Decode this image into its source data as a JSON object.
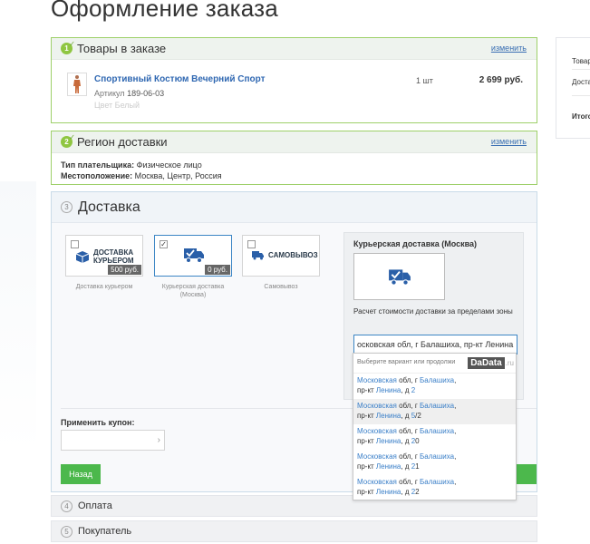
{
  "page": {
    "title": "Оформление заказа"
  },
  "products": {
    "step": "1",
    "title": "Товары в заказе",
    "edit": "изменить",
    "item": {
      "name": "Спортивный Костюм Вечерний Спорт",
      "article_label": "Артикул",
      "article": "189-06-03",
      "color": "Цвет Белый",
      "qty": "1 шт",
      "price": "2 699 руб."
    }
  },
  "region": {
    "step": "2",
    "title": "Регион доставки",
    "edit": "изменить",
    "payer_label": "Тип плательщика:",
    "payer": "Физическое лицо",
    "location_label": "Местоположение:",
    "location": "Москва, Центр, Россия"
  },
  "delivery": {
    "step": "3",
    "title": "Доставка",
    "options": [
      {
        "logo": "ДОСТАВКА КУРЬЕРОМ",
        "price": "500 руб.",
        "caption": "Доставка курьером",
        "checked": ""
      },
      {
        "logo": "",
        "price": "0 руб.",
        "caption": "Курьерская доставка (Москва)",
        "checked": "✓"
      },
      {
        "logo": "САМОВЫВОЗ",
        "price": "",
        "caption": "Самовывоз",
        "checked": ""
      }
    ],
    "panel": {
      "title": "Курьерская доставка (Москва)",
      "desc": "Расчет стоимости доставки за пределами зоны",
      "address_value": "осковская обл, г Балашиха, пр-кт Ленина, д"
    },
    "coupon_label": "Применить купон:",
    "back": "Назад"
  },
  "suggest": {
    "hint": "Выберите вариант или продолжи",
    "brand": "DaData",
    "brand_suffix": ".ru",
    "items": [
      {
        "a": "Московская",
        "b": " обл, г ",
        "c": "Балашиха",
        "d": ",",
        "e": "пр-кт ",
        "f": "Ленина",
        "g": ", д ",
        "h": "2",
        "i": ""
      },
      {
        "a": "Московская",
        "b": " обл, г ",
        "c": "Балашиха",
        "d": ",",
        "e": "пр-кт ",
        "f": "Ленина",
        "g": ", д ",
        "h": "5",
        "i": "/2"
      },
      {
        "a": "Московская",
        "b": " обл, г ",
        "c": "Балашиха",
        "d": ",",
        "e": "пр-кт ",
        "f": "Ленина",
        "g": ", д ",
        "h": "2",
        "i": "0"
      },
      {
        "a": "Московская",
        "b": " обл, г ",
        "c": "Балашиха",
        "d": ",",
        "e": "пр-кт ",
        "f": "Ленина",
        "g": ", д ",
        "h": "2",
        "i": "1"
      },
      {
        "a": "Московская",
        "b": " обл, г ",
        "c": "Балашиха",
        "d": ",",
        "e": "пр-кт ",
        "f": "Ленина",
        "g": ", д ",
        "h": "2",
        "i": "2"
      }
    ]
  },
  "payment": {
    "step": "4",
    "title": "Оплата"
  },
  "buyer": {
    "step": "5",
    "title": "Покупатель"
  },
  "sidebar": {
    "row1": "Товары",
    "row2": "Доставка",
    "row3": "Итого"
  }
}
